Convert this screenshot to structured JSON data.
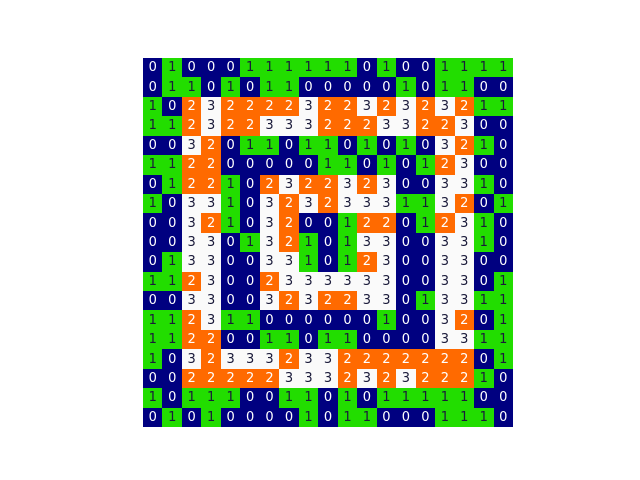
{
  "palette": {
    "0": {
      "bg": "#000080",
      "fg": "#ffffff"
    },
    "1": {
      "bg": "#22dd00",
      "fg": "#1a1a3a"
    },
    "2": {
      "bg": "#ff6a00",
      "fg": "#ffffff"
    },
    "3": {
      "bg": "#fafafa",
      "fg": "#1a1a3a"
    }
  },
  "grid": [
    [
      0,
      1,
      0,
      0,
      0,
      1,
      1,
      1,
      1,
      1,
      1,
      0,
      1,
      0,
      0,
      1,
      1,
      1,
      1
    ],
    [
      0,
      1,
      1,
      0,
      1,
      0,
      1,
      1,
      0,
      0,
      0,
      0,
      0,
      1,
      0,
      1,
      1,
      0,
      0
    ],
    [
      1,
      0,
      2,
      3,
      2,
      2,
      2,
      2,
      3,
      2,
      2,
      3,
      2,
      3,
      2,
      3,
      2,
      1,
      1
    ],
    [
      1,
      1,
      2,
      3,
      2,
      2,
      3,
      3,
      3,
      2,
      2,
      2,
      3,
      3,
      2,
      2,
      3,
      0,
      0
    ],
    [
      0,
      0,
      3,
      2,
      0,
      1,
      1,
      0,
      1,
      1,
      0,
      1,
      0,
      1,
      0,
      3,
      2,
      1,
      0
    ],
    [
      1,
      1,
      2,
      2,
      0,
      0,
      0,
      0,
      0,
      1,
      1,
      0,
      1,
      0,
      1,
      2,
      3,
      0,
      0
    ],
    [
      0,
      1,
      2,
      2,
      1,
      0,
      2,
      3,
      2,
      2,
      3,
      2,
      3,
      0,
      0,
      3,
      3,
      1,
      0
    ],
    [
      1,
      0,
      3,
      3,
      1,
      0,
      3,
      2,
      3,
      2,
      3,
      3,
      3,
      1,
      1,
      3,
      2,
      0,
      1
    ],
    [
      0,
      0,
      3,
      2,
      1,
      0,
      3,
      2,
      0,
      0,
      1,
      2,
      2,
      0,
      1,
      2,
      3,
      1,
      0
    ],
    [
      0,
      0,
      3,
      3,
      0,
      1,
      3,
      2,
      1,
      0,
      1,
      3,
      3,
      0,
      0,
      3,
      3,
      1,
      0
    ],
    [
      0,
      1,
      3,
      3,
      0,
      0,
      3,
      3,
      1,
      0,
      1,
      2,
      3,
      0,
      0,
      3,
      3,
      0,
      0
    ],
    [
      1,
      1,
      2,
      3,
      0,
      0,
      2,
      3,
      3,
      3,
      3,
      3,
      3,
      0,
      0,
      3,
      3,
      0,
      1
    ],
    [
      0,
      0,
      3,
      3,
      0,
      0,
      3,
      2,
      3,
      2,
      2,
      3,
      3,
      0,
      1,
      3,
      3,
      1,
      1
    ],
    [
      1,
      1,
      2,
      3,
      1,
      1,
      0,
      0,
      0,
      0,
      0,
      0,
      1,
      0,
      0,
      3,
      2,
      0,
      1
    ],
    [
      1,
      1,
      2,
      2,
      0,
      0,
      1,
      1,
      0,
      1,
      1,
      0,
      0,
      0,
      0,
      3,
      3,
      1,
      1
    ],
    [
      1,
      0,
      3,
      2,
      3,
      3,
      3,
      2,
      3,
      3,
      2,
      2,
      2,
      2,
      2,
      2,
      2,
      0,
      1
    ],
    [
      0,
      0,
      2,
      2,
      2,
      2,
      2,
      3,
      3,
      3,
      2,
      3,
      2,
      3,
      2,
      2,
      2,
      1,
      0
    ],
    [
      1,
      0,
      1,
      1,
      1,
      0,
      0,
      1,
      1,
      0,
      1,
      0,
      1,
      1,
      1,
      1,
      1,
      0,
      0
    ],
    [
      0,
      1,
      0,
      1,
      0,
      0,
      0,
      0,
      1,
      0,
      1,
      1,
      0,
      0,
      0,
      1,
      1,
      1,
      0
    ]
  ]
}
